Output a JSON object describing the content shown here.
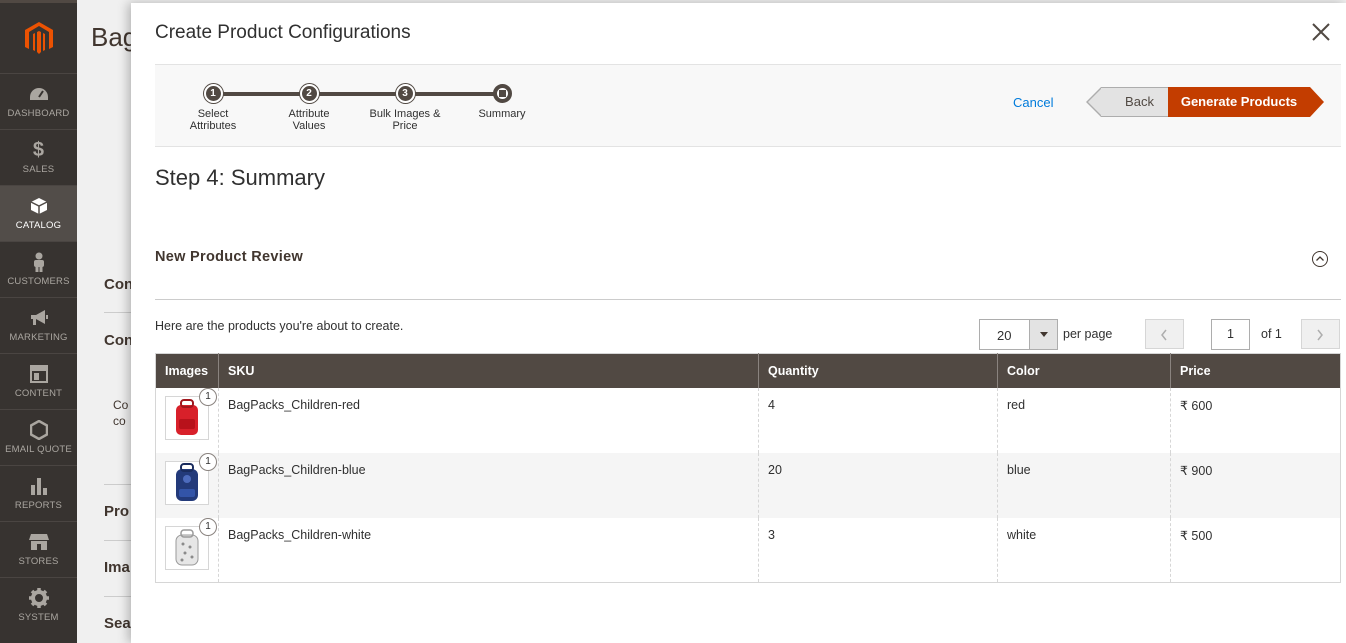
{
  "sidebar": {
    "items": [
      {
        "label": "DASHBOARD",
        "icon": "dashboard-icon"
      },
      {
        "label": "SALES",
        "icon": "dollar-icon"
      },
      {
        "label": "CATALOG",
        "icon": "box-icon",
        "active": true
      },
      {
        "label": "CUSTOMERS",
        "icon": "person-icon"
      },
      {
        "label": "MARKETING",
        "icon": "megaphone-icon"
      },
      {
        "label": "CONTENT",
        "icon": "layout-icon"
      },
      {
        "label": "EMAIL QUOTE",
        "icon": "hexagon-icon"
      },
      {
        "label": "REPORTS",
        "icon": "bar-chart-icon"
      },
      {
        "label": "STORES",
        "icon": "store-icon"
      },
      {
        "label": "SYSTEM",
        "icon": "gear-icon"
      }
    ]
  },
  "background": {
    "title": "Bag",
    "labels": [
      "Con",
      "Con",
      "Pro",
      "Ima",
      "Sea"
    ],
    "small": [
      "Co",
      "co"
    ]
  },
  "modal": {
    "title": "Create Product Configurations",
    "wizard": {
      "steps": [
        {
          "num": "1",
          "label_line1": "Select",
          "label_line2": "Attributes"
        },
        {
          "num": "2",
          "label_line1": "Attribute",
          "label_line2": "Values"
        },
        {
          "num": "3",
          "label_line1": "Bulk Images &",
          "label_line2": "Price"
        },
        {
          "num": "",
          "label_line1": "Summary",
          "label_line2": ""
        }
      ],
      "current_step": 4,
      "cancel_label": "Cancel",
      "back_label": "Back",
      "generate_label": "Generate Products"
    },
    "step_title": "Step 4: Summary",
    "section_title": "New Product Review",
    "intro": "Here are the products you're about to create.",
    "pager": {
      "per_page_value": "20",
      "per_page_label": "per page",
      "page_value": "1",
      "of_label": "of 1"
    },
    "table": {
      "headers": [
        "Images",
        "SKU",
        "Quantity",
        "Color",
        "Price"
      ],
      "rows": [
        {
          "image_count": "1",
          "sku": "BagPacks_Children-red",
          "quantity": "4",
          "color": "red",
          "price": "₹ 600",
          "swatch": "#d8202a"
        },
        {
          "image_count": "1",
          "sku": "BagPacks_Children-blue",
          "quantity": "20",
          "color": "blue",
          "price": "₹ 900",
          "swatch": "#233a7a"
        },
        {
          "image_count": "1",
          "sku": "BagPacks_Children-white",
          "quantity": "3",
          "color": "white",
          "price": "₹ 500",
          "swatch": "#d9d9d9"
        }
      ]
    }
  },
  "colors": {
    "sidebar_bg": "#373330",
    "accent": "#c33d00",
    "header_bg": "#514943",
    "link": "#007bdb"
  }
}
